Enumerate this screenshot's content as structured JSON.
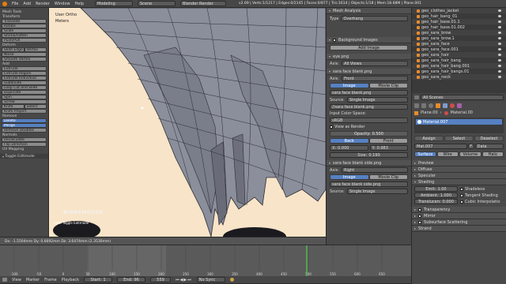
{
  "top_menu": {
    "items": [
      "File",
      "Add",
      "Render",
      "Window",
      "Help"
    ],
    "layout": "Modeling",
    "scene": "Scene",
    "engine": "Blender Render",
    "stats": "v2.69 | Verts:1/1217 | Edges:0/2145 | Faces:0/877 | Tris:1614 | Objects:1/18 | Mem:18.68M | Plane.001"
  },
  "tool_shelf": {
    "title": "Mesh Tools",
    "sections": [
      {
        "name": "Transform",
        "buttons": [
          "Translate",
          "Rotate",
          "Scale",
          "Shrink/Fatten",
          "Push/Pull"
        ]
      },
      {
        "name": "Deform",
        "buttons": [
          "Slide Edge",
          "Vertex",
          "Noise",
          "Smooth Vertex"
        ]
      },
      {
        "name": "Add",
        "buttons": [
          "Extrude",
          "Extrude Region",
          "Extrude Individual",
          "Subdivide",
          "Loop Cut and Slide",
          "Duplicate",
          "Spin",
          "Screw",
          "Knife",
          "Select",
          "Knife Project"
        ]
      },
      {
        "name": "Remove",
        "buttons": [
          "Delete",
          "Merge",
          "Remove Doubles"
        ]
      },
      {
        "name": "Normals",
        "buttons": [
          "Recalculate",
          "Flip Direction"
        ]
      },
      {
        "name": "UV Mapping",
        "buttons": []
      }
    ],
    "toggle": "Toggle Editmode"
  },
  "viewport": {
    "view_name": "User Ortho",
    "object_name": "Meters",
    "overlay_text": "RIGHTMOUSE",
    "last_op": "Last: Toggle Editmode",
    "status": "Dx: -1.5504mm  Dy: 0.6692mm  Dz: 3.6474mm  (2.3530mm)",
    "skin_color": "#f8e4c8",
    "hair_color": "#8b8e9b",
    "wire_color": "#2c2c33"
  },
  "properties": {
    "mesh_analysis": "Mesh Analysis",
    "type_label": "Type",
    "type_value": "Overhang",
    "background_images": "Background Images",
    "add_image": "Add Image",
    "images": [
      {
        "name": "eye.png",
        "axis_label": "Axis:",
        "axis": "All Views"
      },
      {
        "name": "sara face blank.png",
        "axis_label": "Axis:",
        "axis": "Front",
        "tabs": [
          "Image",
          "Movie Clip"
        ],
        "file": "sara face blank.png",
        "source_label": "Source:",
        "source": "Single Image",
        "path": "//sara face blank.png",
        "color_space_label": "Input Color Space:",
        "color_space": "sRGB",
        "view_as_render": "View as Render",
        "opacity_label": "Opacity:",
        "opacity": "0.500",
        "back_front": [
          "Back",
          "Front"
        ],
        "x_label": "X:",
        "x": "0.000",
        "y_label": "Y:",
        "y": "0.983",
        "size_label": "Size:",
        "size": "0.190"
      },
      {
        "name": "sara face blank side.png",
        "axis_label": "Axis:",
        "axis": "Right",
        "tabs": [
          "Image",
          "Movie Clip"
        ],
        "file": "sara face blank side.png",
        "source_label": "Source:",
        "source": "Single Image"
      }
    ]
  },
  "outliner": {
    "items": [
      "geo_clothes_jacket",
      "geo_hair_bang_01",
      "geo_hair_base.01.1",
      "geo_hair_base.01.002",
      "geo_sara_brow",
      "geo_sara_brow.1",
      "geo_sara_face",
      "geo_sara_face.001",
      "geo_sara_hair",
      "geo_sara_hair_bang",
      "geo_sara_hair_bang.001",
      "geo_sara_hair_bangs.01",
      "geo_sara_neck"
    ]
  },
  "material_panel": {
    "header_label": "All Scenes",
    "breadcrumb": [
      "Plane.00",
      "Material.00"
    ],
    "slot": "Material.007",
    "actions": [
      "Assign",
      "Select",
      "Deselect"
    ],
    "mat_field": "Mat.007",
    "mat_field_extra": "F",
    "data_field": "Data",
    "tabs": [
      "Surface",
      "Wire",
      "Volume",
      "Halo"
    ],
    "sections": [
      "Preview",
      "Diffuse",
      "Specular",
      "Shading",
      "Transparency",
      "Mirror",
      "Subsurface Scattering",
      "Strand"
    ],
    "shading": {
      "emit_label": "Emit:",
      "emit": "1.00",
      "ambient_label": "Ambient:",
      "ambient": "1.000",
      "translucency_label": "Translucen:",
      "translucency": "0.000",
      "checks": [
        "Shadeless",
        "Tangent Shading",
        "Cubic Interpolatio"
      ]
    },
    "color": "#ffffff"
  },
  "timeline": {
    "menu": [
      "View",
      "Marker",
      "Frame",
      "Playback"
    ],
    "start_label": "Start:",
    "start": "1",
    "end_label": "End:",
    "end": "96",
    "current": "559",
    "sync": "No Sync",
    "ticks": [
      "-100",
      "-50",
      "0",
      "50",
      "100",
      "150",
      "200",
      "250",
      "300",
      "350",
      "400",
      "450",
      "500",
      "550",
      "600",
      "650"
    ]
  }
}
